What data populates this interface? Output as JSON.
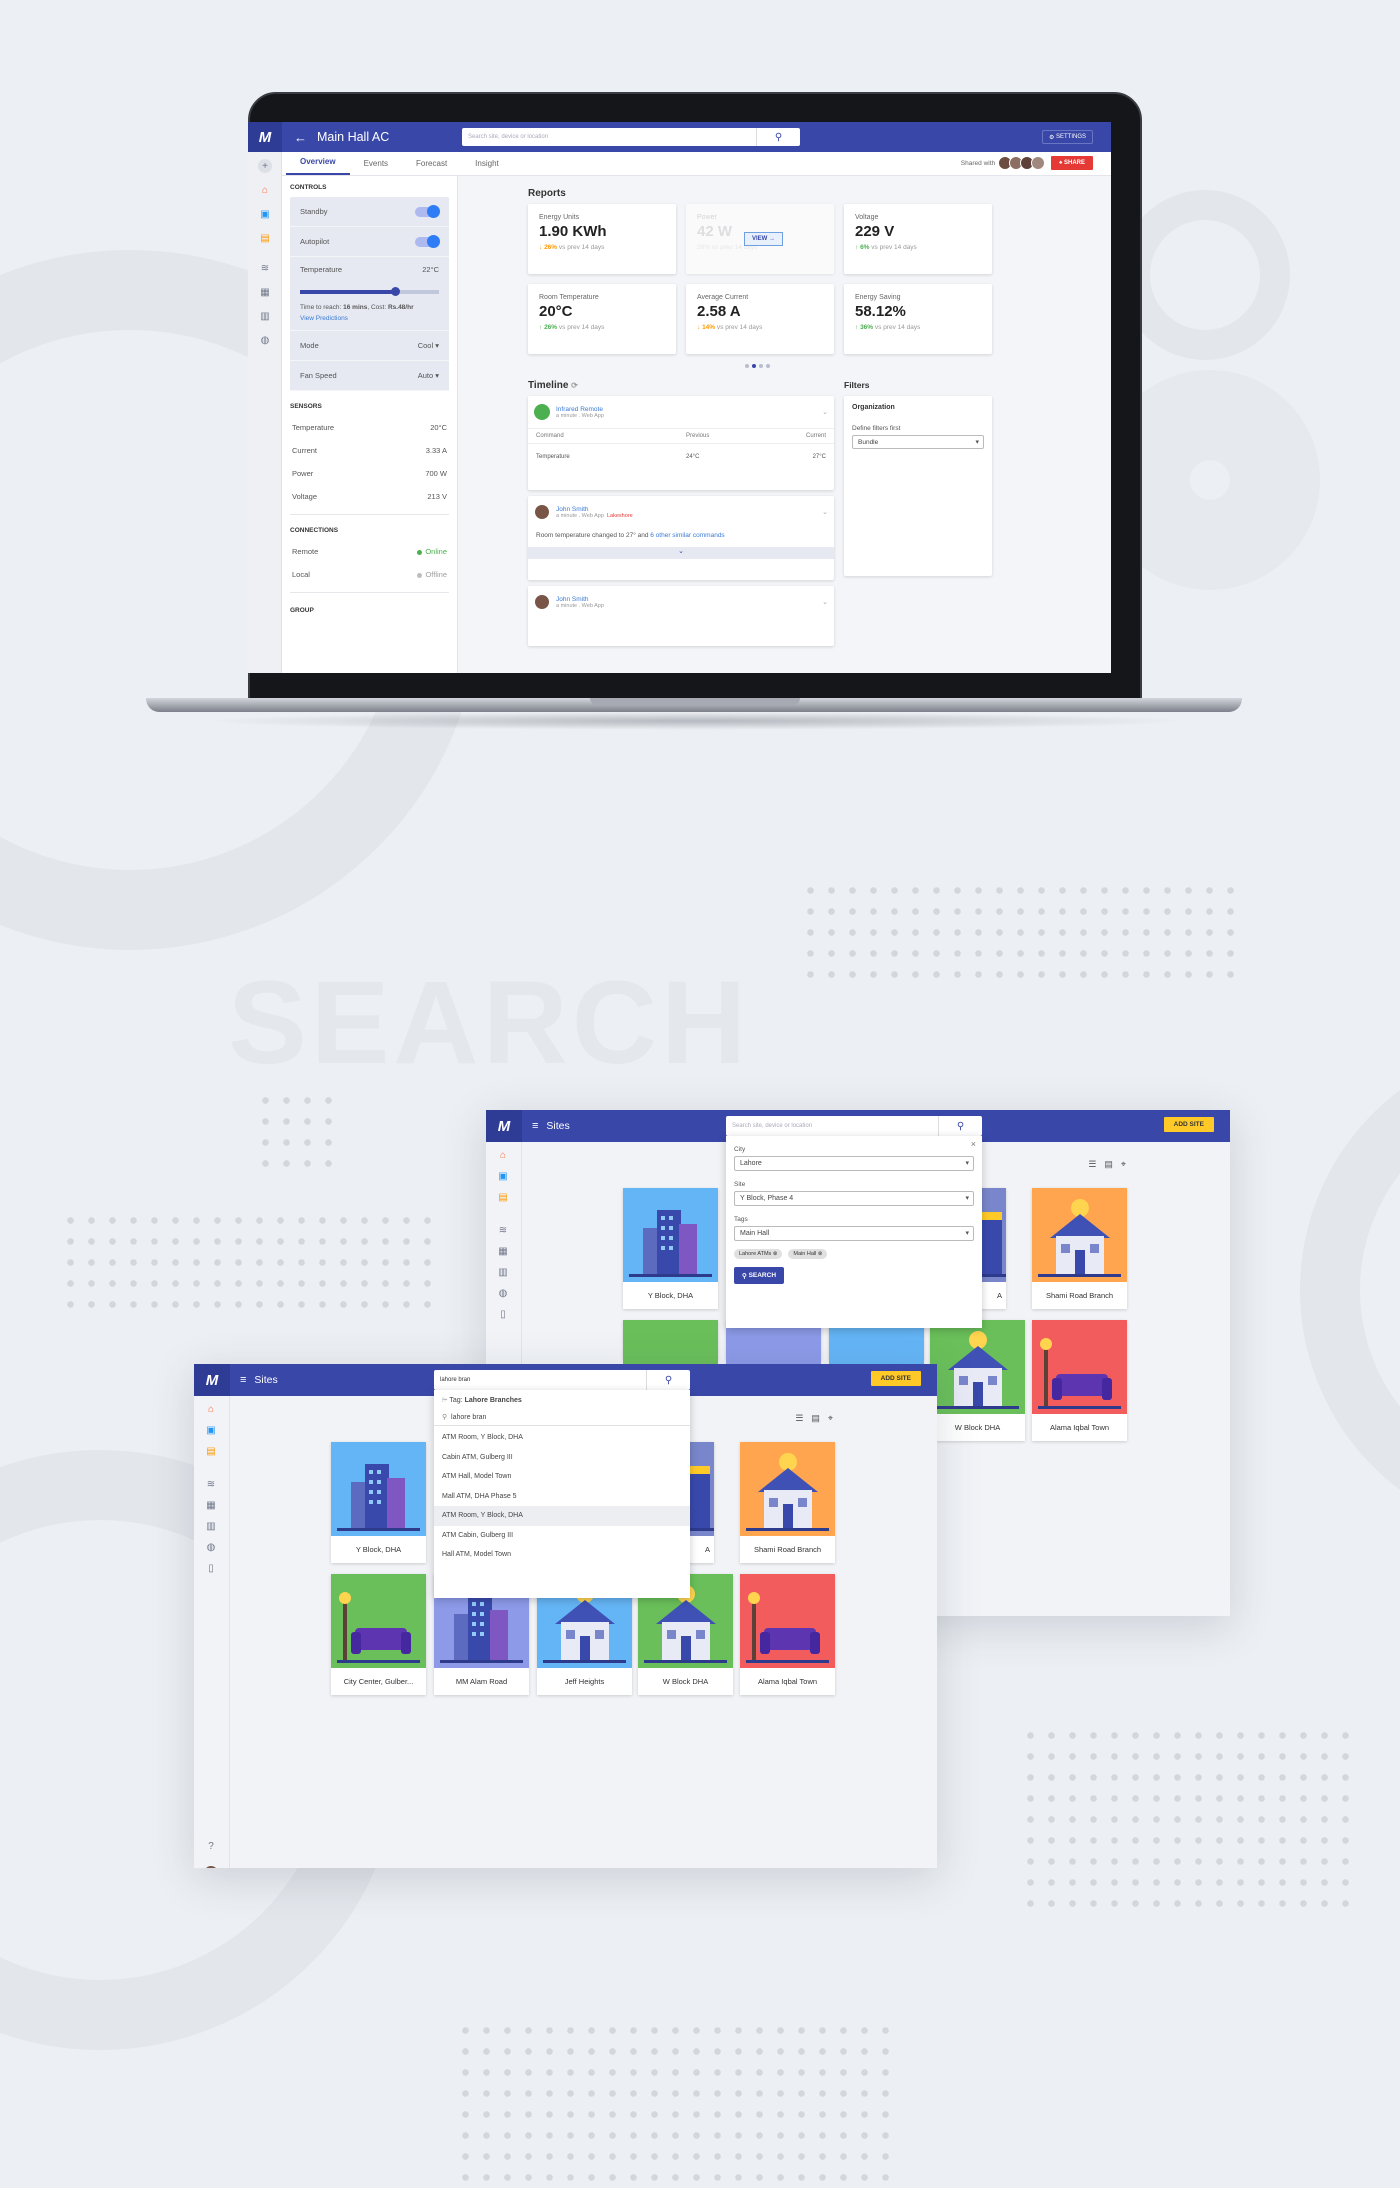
{
  "section_heading": "SEARCH",
  "colors": {
    "primary": "#3947a8",
    "accent_red": "#e53935",
    "accent_yellow": "#ffca28",
    "link": "#3a7bd5"
  },
  "device": {
    "logo": "M",
    "title": "Main Hall AC",
    "search_placeholder": "Search site, device or location",
    "settings_label": "SETTINGS",
    "tabs": [
      "Overview",
      "Events",
      "Forecast",
      "Insight"
    ],
    "shared_with_label": "Shared with",
    "share_label": "SHARE",
    "controls": {
      "heading": "CONTROLS",
      "standby": "Standby",
      "autopilot": "Autopilot",
      "temperature_label": "Temperature",
      "temperature_value": "22°C",
      "temperature_slider_fraction": 0.68,
      "time_to_reach_label": "Time to reach:",
      "time_to_reach_value": "16 mins",
      "cost_label": ", Cost:",
      "cost_value": "Rs.48/hr",
      "view_predictions": "View Predictions",
      "mode_label": "Mode",
      "mode_value": "Cool",
      "fan_label": "Fan Speed",
      "fan_value": "Auto"
    },
    "sensors": {
      "heading": "SENSORS",
      "items": [
        {
          "label": "Temperature",
          "value": "20°C"
        },
        {
          "label": "Current",
          "value": "3.33 A"
        },
        {
          "label": "Power",
          "value": "700 W"
        },
        {
          "label": "Voltage",
          "value": "213 V"
        }
      ]
    },
    "connections": {
      "heading": "CONNECTIONS",
      "items": [
        {
          "label": "Remote",
          "status": "Online"
        },
        {
          "label": "Local",
          "status": "Offline"
        }
      ]
    },
    "group_heading": "GROUP",
    "reports": {
      "heading": "Reports",
      "cards": [
        {
          "label": "Energy Units",
          "value": "1.90 KWh",
          "change": "26%",
          "dir": "down",
          "period": "vs prev 14 days"
        },
        {
          "label": "Power",
          "value": "42 W",
          "change": "26%",
          "dir": "down",
          "period": "vs prev 14 days"
        },
        {
          "label": "Voltage",
          "value": "229 V",
          "change": "6%",
          "dir": "up",
          "period": "vs prev 14 days"
        },
        {
          "label": "Room Temperature",
          "value": "20°C",
          "change": "26%",
          "dir": "up",
          "period": "vs prev 14 days"
        },
        {
          "label": "Average Current",
          "value": "2.58 A",
          "change": "14%",
          "dir": "down",
          "period": "vs prev 14 days"
        },
        {
          "label": "Energy Saving",
          "value": "58.12%",
          "change": "36%",
          "dir": "up",
          "period": "vs prev 14 days"
        }
      ],
      "view_button": "VIEW →"
    },
    "timeline": {
      "heading": "Timeline",
      "item1": {
        "name": "Infrared Remote",
        "sub": "a minute . Web App",
        "col_command": "Command",
        "col_previous": "Previous",
        "col_current": "Current",
        "row_command": "Temperature",
        "row_previous": "24°C",
        "row_current": "27°C"
      },
      "item2": {
        "name": "John Smith",
        "sub": "a minute . Web App",
        "tag": "Lakeshore",
        "text": "Room temperature changed to 27° and",
        "link": "6 other similar commands"
      },
      "item3": {
        "name": "John Smith",
        "sub": "a minute . Web App"
      }
    },
    "filters": {
      "heading": "Filters",
      "organization": "Organization",
      "define_label": "Define filters first",
      "select_value": "Bundle"
    }
  },
  "sites_back": {
    "title": "Sites",
    "add_site": "ADD SITE",
    "search_placeholder": "Search site, device or location",
    "filter": {
      "city_label": "City",
      "city_value": "Lahore",
      "site_label": "Site",
      "site_value": "Y Block, Phase 4",
      "tags_label": "Tags",
      "tags_value": "Main Hall",
      "chips": [
        "Lahore ATMs",
        "Main Hall"
      ],
      "search_button": "SEARCH"
    },
    "tiles": [
      "Y Block, DHA",
      "A",
      "Shami Road Branch",
      "W Block DHA",
      "Alama Iqbal Town"
    ]
  },
  "sites_front": {
    "title": "Sites",
    "add_site": "ADD SITE",
    "search_value": "lahore bran",
    "suggestions": {
      "tag_prefix": "Tag:",
      "tag_value": "Lahore Branches",
      "query": "lahore bran",
      "items": [
        "ATM Room, Y Block, DHA",
        "Cabin ATM, Gulberg III",
        "ATM Hall, Model Town",
        "Mall ATM, DHA Phase 5",
        "ATM Room, Y Block, DHA",
        "ATM Cabin, Gulberg III",
        "Hall ATM, Model Town"
      ]
    },
    "tiles": [
      "Y Block, DHA",
      "A",
      "Shami Road Branch",
      "City Center, Gulber...",
      "MM Alam Road",
      "Jeff Heights",
      "W Block DHA",
      "Alama Iqbal Town"
    ]
  }
}
